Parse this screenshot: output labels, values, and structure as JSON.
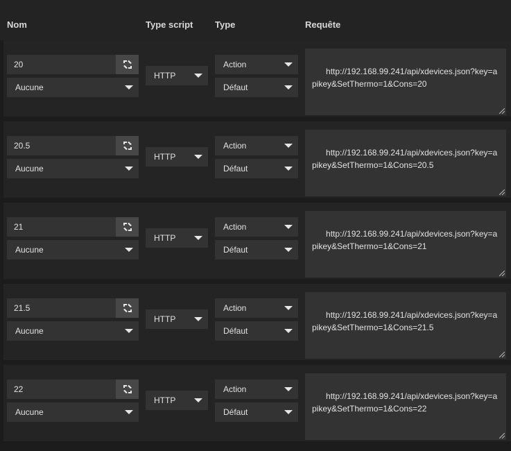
{
  "headers": {
    "nom": "Nom",
    "type_script": "Type script",
    "type": "Type",
    "requete": "Requête"
  },
  "icons": {
    "name_button": "swap-icon",
    "dropdown": "caret-down-icon",
    "resize": "resize-handle-icon"
  },
  "rows": [
    {
      "name": "20",
      "option": "Aucune",
      "script_type": "HTTP",
      "type": "Action",
      "subtype": "Défaut",
      "request": "http://192.168.99.241/api/xdevices.json?key=apikey&SetThermo=1&Cons=20"
    },
    {
      "name": "20.5",
      "option": "Aucune",
      "script_type": "HTTP",
      "type": "Action",
      "subtype": "Défaut",
      "request": "http://192.168.99.241/api/xdevices.json?key=apikey&SetThermo=1&Cons=20.5"
    },
    {
      "name": "21",
      "option": "Aucune",
      "script_type": "HTTP",
      "type": "Action",
      "subtype": "Défaut",
      "request": "http://192.168.99.241/api/xdevices.json?key=apikey&SetThermo=1&Cons=21"
    },
    {
      "name": "21.5",
      "option": "Aucune",
      "script_type": "HTTP",
      "type": "Action",
      "subtype": "Défaut",
      "request": "http://192.168.99.241/api/xdevices.json?key=apikey&SetThermo=1&Cons=21.5"
    },
    {
      "name": "22",
      "option": "Aucune",
      "script_type": "HTTP",
      "type": "Action",
      "subtype": "Défaut",
      "request": "http://192.168.99.241/api/xdevices.json?key=apikey&SetThermo=1&Cons=22"
    }
  ]
}
